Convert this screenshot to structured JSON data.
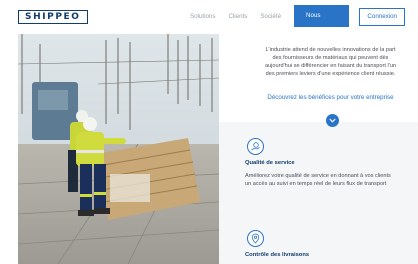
{
  "header": {
    "logo_text": "SHIPPEO",
    "nav": {
      "solutions": "Solutions",
      "clients": "Clients",
      "societe": "Société",
      "contact": "Nous contacter",
      "login": "Connexion"
    }
  },
  "intro": {
    "line1": "L'industrie attend de nouvelles innovations de la part",
    "line2": "des fournisseurs de matériaux qui peuvent dès",
    "line3": "aujourd'hui se différencier en faisant du transport l'un",
    "line4": "des premiers leviers d'une expérience client réussie.",
    "discover_link": "Découvrez les bénéfices pour votre entreprise"
  },
  "features": {
    "quality": {
      "title": "Qualité de service",
      "line1": "Améliorez votre qualité de service en donnant à vos clients",
      "line2": "un accès au suivi en temps réel de leurs flux de transport"
    },
    "delivery": {
      "title": "Contrôle des livraisons"
    }
  },
  "colors": {
    "brand_navy": "#123d6d",
    "accent_blue": "#2a74c7",
    "panel_grey": "#f4f6f8"
  }
}
